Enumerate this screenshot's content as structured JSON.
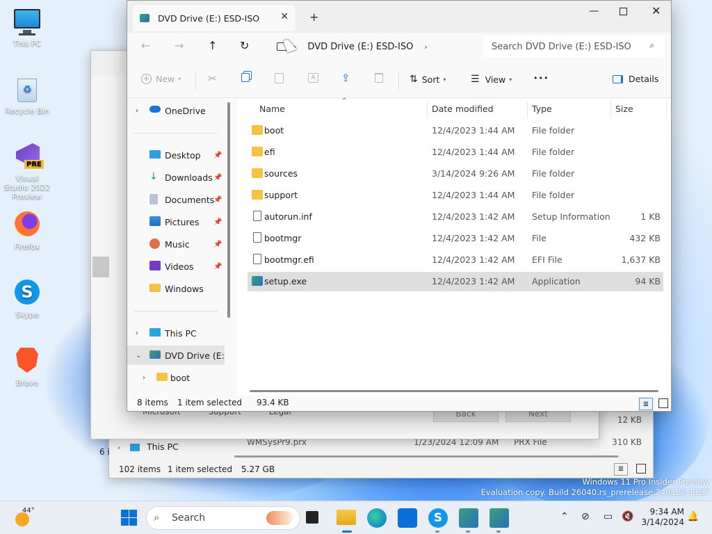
{
  "desktop": {
    "icons": [
      {
        "label": "This PC"
      },
      {
        "label": "Recycle Bin"
      },
      {
        "label": "Visual Studio 2022 Preview",
        "badge": "PRE"
      },
      {
        "label": "Firefox"
      },
      {
        "label": "Skype"
      },
      {
        "label": "Brave"
      }
    ],
    "watermark_line1": "Windows 11 Pro Insider Preview",
    "watermark_line2": "Evaluation copy. Build 26040.rs_prerelease.240122-1157"
  },
  "back_window": {
    "nav_this_pc": "This PC",
    "file_row_name": "WMSysPr9.prx",
    "file_row_date": "1/23/2024 12:09 AM",
    "file_row_type": "PRX File",
    "file_row_size": "310 KB",
    "size_above": "12 KB",
    "status_count": "102 items",
    "status_selected": "1 item selected",
    "status_size": "5.27 GB",
    "partial_count": "6 i",
    "dialog_links": [
      "Microsoft",
      "Support",
      "Legal"
    ],
    "dialog_back": "Back",
    "dialog_next": "Next"
  },
  "explorer": {
    "tab_title": "DVD Drive (E:) ESD-ISO",
    "address_segment": "DVD Drive (E:) ESD-ISO",
    "search_placeholder": "Search DVD Drive (E:) ESD-ISO",
    "toolbar": {
      "new": "New",
      "sort": "Sort",
      "view": "View",
      "more": "•••",
      "details": "Details"
    },
    "nav": {
      "onedrive": "OneDrive",
      "desktop": "Desktop",
      "downloads": "Downloads",
      "documents": "Documents",
      "pictures": "Pictures",
      "music": "Music",
      "videos": "Videos",
      "windows": "Windows",
      "this_pc": "This PC",
      "dvd": "DVD Drive (E:) ESD-ISO",
      "boot": "boot"
    },
    "columns": {
      "name": "Name",
      "date": "Date modified",
      "type": "Type",
      "size": "Size"
    },
    "files": [
      {
        "name": "boot",
        "date": "12/4/2023 1:44 AM",
        "type": "File folder",
        "size": "",
        "icon": "folder-icon"
      },
      {
        "name": "efi",
        "date": "12/4/2023 1:44 AM",
        "type": "File folder",
        "size": "",
        "icon": "folder-icon"
      },
      {
        "name": "sources",
        "date": "3/14/2024 9:26 AM",
        "type": "File folder",
        "size": "",
        "icon": "folder-icon"
      },
      {
        "name": "support",
        "date": "12/4/2023 1:44 AM",
        "type": "File folder",
        "size": "",
        "icon": "folder-icon"
      },
      {
        "name": "autorun.inf",
        "date": "12/4/2023 1:42 AM",
        "type": "Setup Information",
        "size": "1 KB",
        "icon": "settings-file-icon"
      },
      {
        "name": "bootmgr",
        "date": "12/4/2023 1:42 AM",
        "type": "File",
        "size": "432 KB",
        "icon": "file-icon"
      },
      {
        "name": "bootmgr.efi",
        "date": "12/4/2023 1:42 AM",
        "type": "EFI File",
        "size": "1,637 KB",
        "icon": "file-icon"
      },
      {
        "name": "setup.exe",
        "date": "12/4/2023 1:42 AM",
        "type": "Application",
        "size": "94 KB",
        "icon": "setup-icon",
        "selected": true
      }
    ],
    "status": {
      "count": "8 items",
      "selected": "1 item selected",
      "size": "93.4 KB"
    }
  },
  "taskbar": {
    "weather_temp": "44°",
    "search_label": "Search",
    "time": "9:34 AM",
    "date": "3/14/2024"
  },
  "colors": {
    "accent": "#0067c0",
    "folder": "#f5c242",
    "selection": "#dedede"
  }
}
